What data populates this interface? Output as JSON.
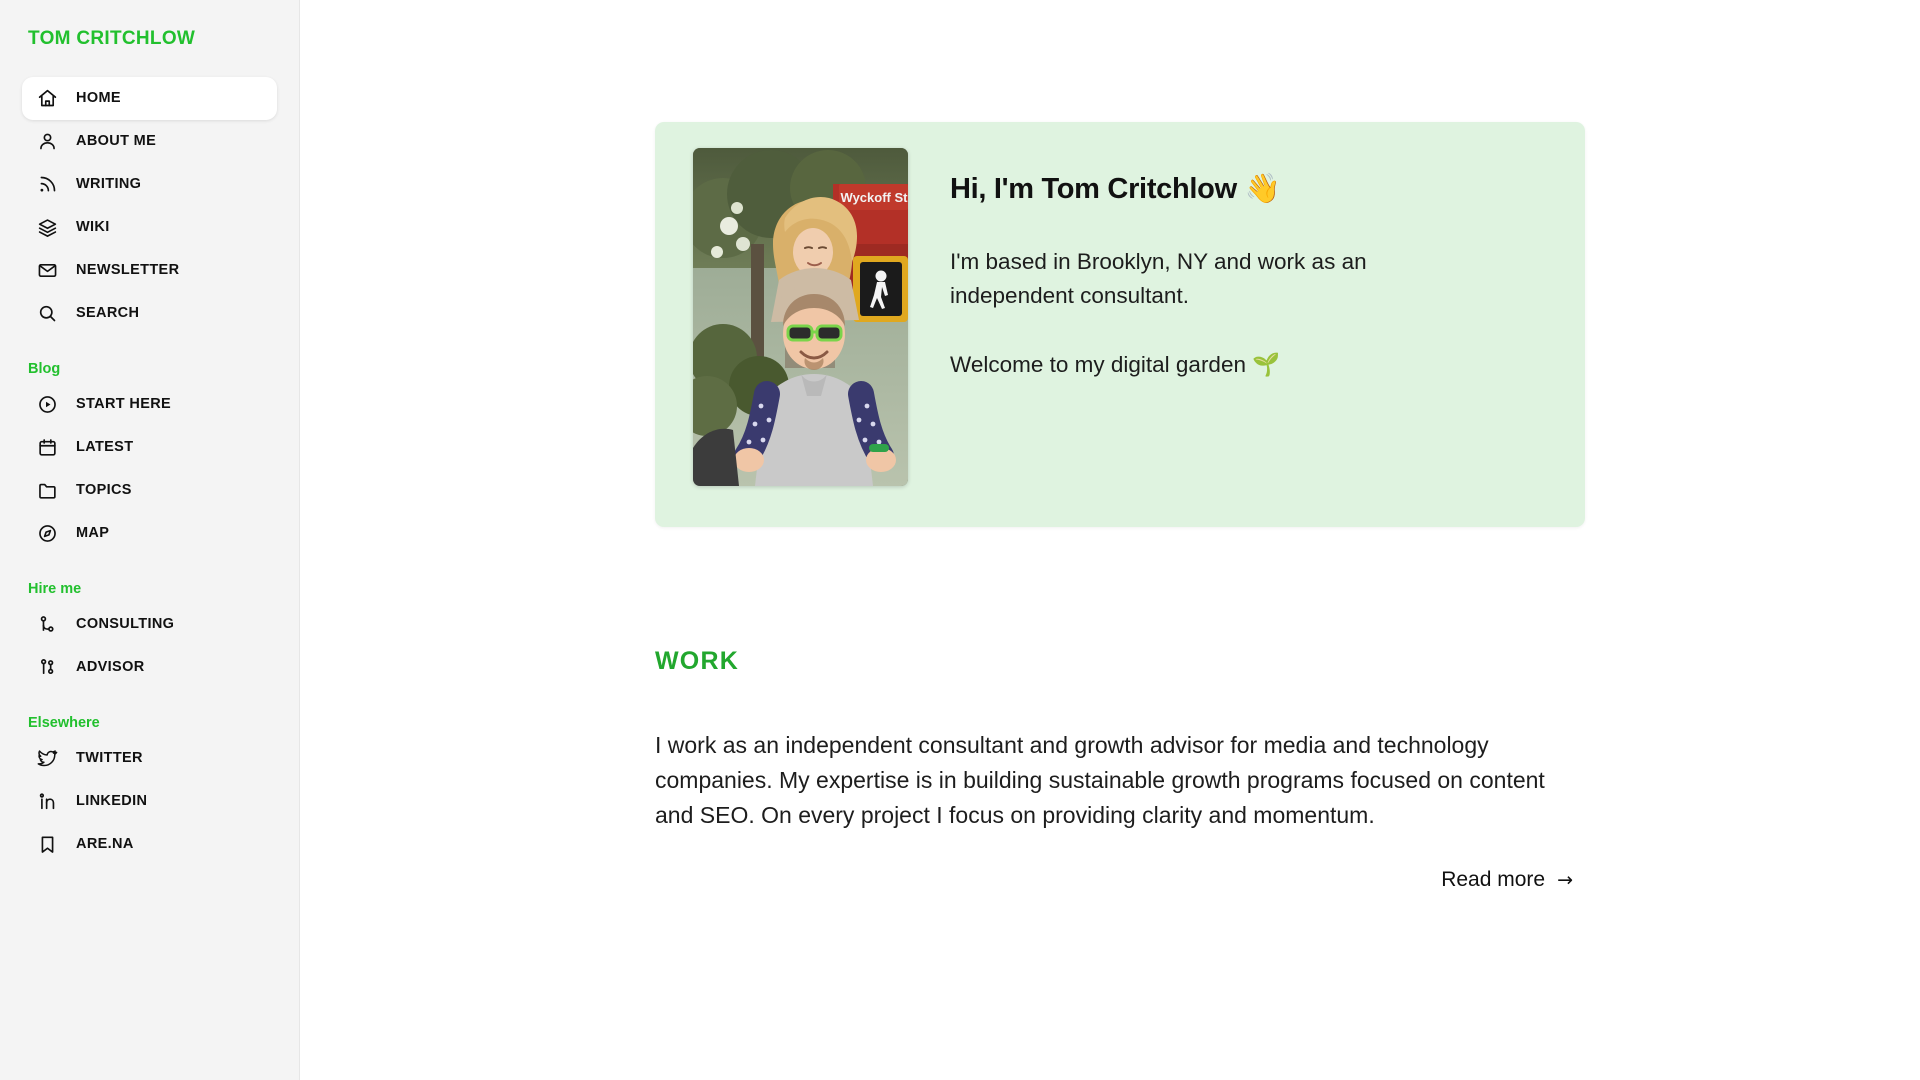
{
  "sidebar": {
    "brand": "TOM CRITCHLOW",
    "main_items": [
      {
        "label": "HOME",
        "icon": "home-icon",
        "active": true
      },
      {
        "label": "ABOUT ME",
        "icon": "person-icon",
        "active": false
      },
      {
        "label": "WRITING",
        "icon": "rss-icon",
        "active": false
      },
      {
        "label": "WIKI",
        "icon": "layers-icon",
        "active": false
      },
      {
        "label": "NEWSLETTER",
        "icon": "envelope-icon",
        "active": false
      },
      {
        "label": "SEARCH",
        "icon": "search-icon",
        "active": false
      }
    ],
    "groups": [
      {
        "title": "Blog",
        "items": [
          {
            "label": "START HERE",
            "icon": "play-circle-icon"
          },
          {
            "label": "LATEST",
            "icon": "calendar-icon"
          },
          {
            "label": "TOPICS",
            "icon": "folder-icon"
          },
          {
            "label": "MAP",
            "icon": "compass-icon"
          }
        ]
      },
      {
        "title": "Hire me",
        "items": [
          {
            "label": "CONSULTING",
            "icon": "git-branch-icon"
          },
          {
            "label": "ADVISOR",
            "icon": "git-merge-icon"
          }
        ]
      },
      {
        "title": "Elsewhere",
        "items": [
          {
            "label": "TWITTER",
            "icon": "twitter-icon"
          },
          {
            "label": "LINKEDIN",
            "icon": "linkedin-icon"
          },
          {
            "label": "ARE.NA",
            "icon": "bookmark-icon"
          }
        ]
      }
    ]
  },
  "hero": {
    "heading": "Hi, I'm Tom Critchlow ",
    "heading_emoji": "👋",
    "paragraph_1": "I'm based in Brooklyn, NY and work as an independent consultant.",
    "paragraph_2": "Welcome to my digital garden ",
    "paragraph_2_emoji": "🌱",
    "photo_alt": "Man with green sunglasses carrying a child on his shoulders on a Brooklyn street, Wyckoff St sign in background",
    "photo_sign_text": "Wyckoff St"
  },
  "work": {
    "heading": "WORK",
    "body": "I work as an independent consultant and growth advisor for media and technology companies. My expertise is in building sustainable growth programs focused on content and SEO. On every project I focus on providing clarity and momentum.",
    "read_more_label": "Read more",
    "read_more_arrow": "→"
  },
  "colors": {
    "accent_green": "#22c02e",
    "heading_green": "#22a72e",
    "card_background": "#dff3e0",
    "sidebar_background": "#f4f4f4",
    "page_background": "#ffffff",
    "text": "#111111"
  }
}
